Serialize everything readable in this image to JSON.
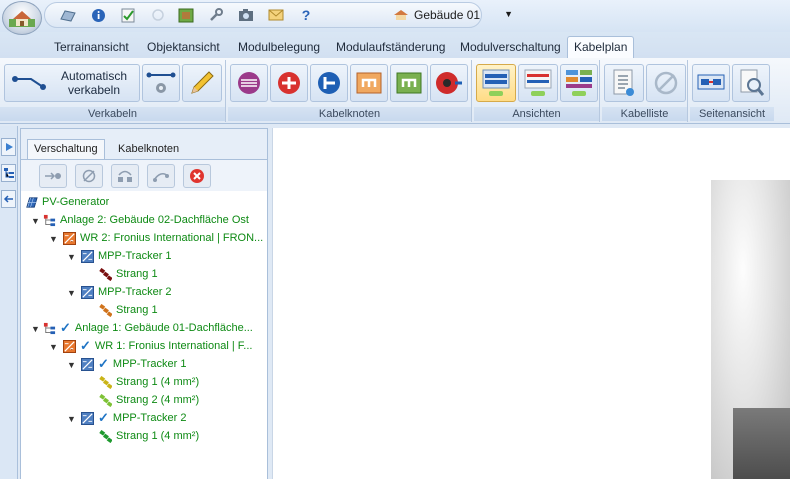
{
  "quick_access": {
    "icons": [
      "open-icon",
      "info-icon",
      "checklist-icon",
      "circle-icon",
      "grid-icon",
      "wrench-icon",
      "camera-icon",
      "envelope-icon",
      "help-icon"
    ],
    "help_label": "?",
    "building_select": "Gebäude 01"
  },
  "tabs": [
    {
      "label": "Terrainansicht"
    },
    {
      "label": "Objektansicht"
    },
    {
      "label": "Modulbelegung"
    },
    {
      "label": "Modulaufständerung"
    },
    {
      "label": "Modulverschaltung"
    },
    {
      "label": "Kabelplan",
      "active": true
    }
  ],
  "ribbon": {
    "groups": {
      "verkabeln": "Verkabeln",
      "kabelknoten": "Kabelknoten",
      "ansichten": "Ansichten",
      "kabelliste": "Kabelliste",
      "seitenansicht": "Seitenansicht"
    },
    "auto_cable_label": "Automatisch verkabeln"
  },
  "panel": {
    "tabs": [
      "Verschaltung",
      "Kabelknoten"
    ],
    "tree": {
      "root": "PV-Generator",
      "anlage2": "Anlage 2:  Gebäude 02-Dachfläche Ost",
      "wr2": "WR 2: Fronius International | FRON...",
      "a2_mpp1": "MPP-Tracker 1",
      "a2_mpp1_s1": "Strang 1",
      "a2_mpp2": "MPP-Tracker 2",
      "a2_mpp2_s1": "Strang 1",
      "anlage1": "Anlage 1:  Gebäude 01-Dachfläche...",
      "wr1": "WR 1: Fronius International | F...",
      "a1_mpp1": "MPP-Tracker 1",
      "a1_mpp1_s1": "Strang 1 (4 mm²)",
      "a1_mpp1_s2": "Strang 2 (4 mm²)",
      "a1_mpp2": "MPP-Tracker 2",
      "a1_mpp2_s1": "Strang 1 (4 mm²)"
    }
  },
  "colors": {
    "accent": "#2b7bd6",
    "tree_text": "#0e8a14",
    "selected_button": "#ffdc86"
  }
}
